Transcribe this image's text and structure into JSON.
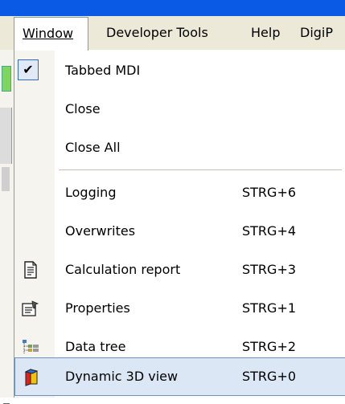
{
  "menubar": {
    "items": [
      {
        "label": "Window"
      },
      {
        "label": "Developer Tools"
      },
      {
        "label": "Help"
      },
      {
        "label": "DigiP"
      }
    ]
  },
  "menu": {
    "items": [
      {
        "label": "Tabbed MDI",
        "checked": true
      },
      {
        "label": "Close"
      },
      {
        "label": "Close All"
      },
      {
        "label": "Logging",
        "shortcut": "STRG+6"
      },
      {
        "label": "Overwrites",
        "shortcut": "STRG+4"
      },
      {
        "label": "Calculation report",
        "shortcut": "STRG+3",
        "icon": "report-icon"
      },
      {
        "label": "Properties",
        "shortcut": "STRG+1",
        "icon": "properties-icon"
      },
      {
        "label": "Data tree",
        "shortcut": "STRG+2",
        "icon": "data-tree-icon"
      },
      {
        "label": "Dynamic 3D view",
        "shortcut": "STRG+0",
        "icon": "3d-view-icon",
        "highlighted": true
      }
    ]
  },
  "colors": {
    "title_bar": "#0a5ae6",
    "menubar_bg": "#ece9d8",
    "highlight_bg": "#dbe7f5",
    "highlight_border": "#6a92c9"
  }
}
